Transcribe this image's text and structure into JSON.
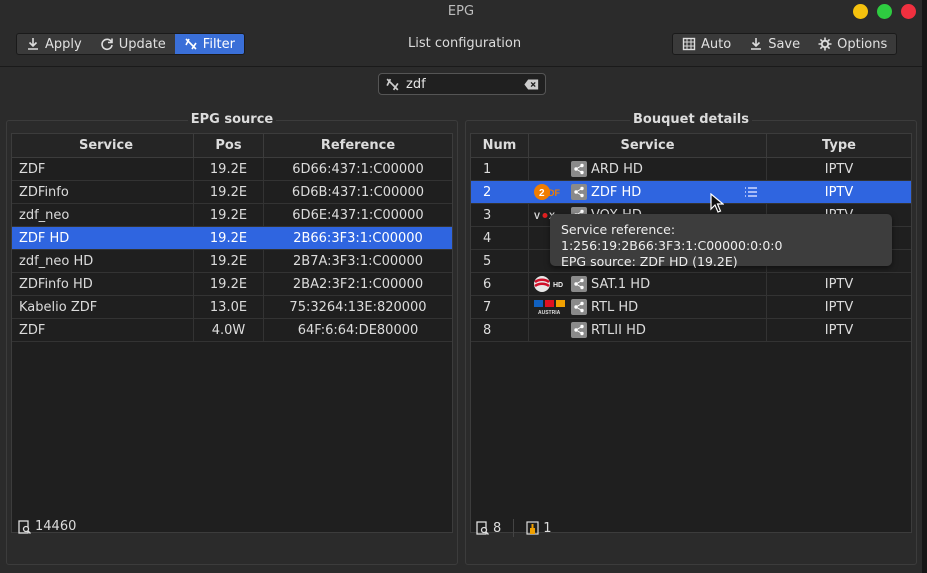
{
  "window": {
    "title": "EPG"
  },
  "toolbar": {
    "apply_label": "Apply",
    "update_label": "Update",
    "filter_label": "Filter",
    "center_label": "List configuration",
    "auto_label": "Auto",
    "save_label": "Save",
    "options_label": "Options"
  },
  "search": {
    "value": "zdf"
  },
  "epg_source": {
    "title": "EPG source",
    "columns": [
      "Service",
      "Pos",
      "Reference"
    ],
    "rows": [
      {
        "service": "ZDF",
        "pos": "19.2E",
        "ref": "6D66:437:1:C00000"
      },
      {
        "service": "ZDFinfo",
        "pos": "19.2E",
        "ref": "6D6B:437:1:C00000"
      },
      {
        "service": "zdf_neo",
        "pos": "19.2E",
        "ref": "6D6E:437:1:C00000"
      },
      {
        "service": "ZDF HD",
        "pos": "19.2E",
        "ref": "2B66:3F3:1:C00000"
      },
      {
        "service": "zdf_neo HD",
        "pos": "19.2E",
        "ref": "2B7A:3F3:1:C00000"
      },
      {
        "service": "ZDFinfo HD",
        "pos": "19.2E",
        "ref": "2BA2:3F2:1:C00000"
      },
      {
        "service": "Kabelio ZDF",
        "pos": "13.0E",
        "ref": "75:3264:13E:820000"
      },
      {
        "service": "ZDF",
        "pos": "4.0W",
        "ref": "64F:6:64:DE80000"
      }
    ],
    "selected_index": 3,
    "footer_count": "14460"
  },
  "bouquet": {
    "title": "Bouquet details",
    "columns": [
      "Num",
      "Service",
      "Type"
    ],
    "rows": [
      {
        "num": "1",
        "service": "ARD HD",
        "type": "IPTV",
        "logo": ""
      },
      {
        "num": "2",
        "service": "ZDF HD",
        "type": "IPTV",
        "logo": "zdf-logo"
      },
      {
        "num": "3",
        "service": "VOX HD",
        "type": "IPTV",
        "logo": "vox-logo"
      },
      {
        "num": "4",
        "service": "",
        "type": "",
        "logo": ""
      },
      {
        "num": "5",
        "service": "",
        "type": "",
        "logo": ""
      },
      {
        "num": "6",
        "service": "SAT.1 HD",
        "type": "IPTV",
        "logo": "sat1-logo"
      },
      {
        "num": "7",
        "service": "RTL HD",
        "type": "IPTV",
        "logo": "rtl-logo"
      },
      {
        "num": "8",
        "service": "RTLII HD",
        "type": "IPTV",
        "logo": ""
      }
    ],
    "selected_index": 1,
    "footer_count": "8",
    "footer_marked": "1"
  },
  "tooltip": {
    "line1": "Service reference:  1:256:19:2B66:3F3:1:C00000:0:0:0",
    "line2": "EPG source: ZDF HD (19.2E)"
  },
  "colors": {
    "accent": "#2f65e0",
    "background": "#2b2b2b"
  }
}
